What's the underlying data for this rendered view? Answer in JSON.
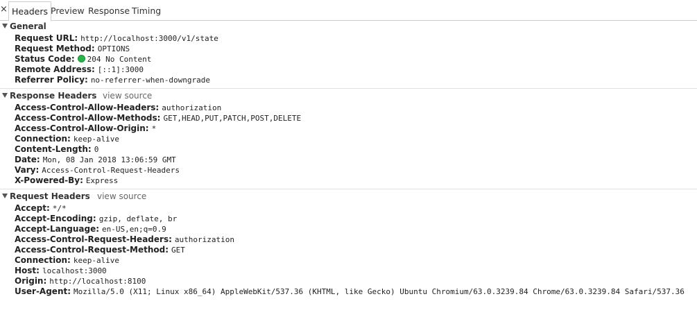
{
  "tabs": {
    "close_symbol": "×",
    "headers": "Headers",
    "preview": "Preview",
    "response": "Response",
    "timing": "Timing"
  },
  "general": {
    "title": "General",
    "request_url_key": "Request URL:",
    "request_url_val": "http://localhost:3000/v1/state",
    "request_method_key": "Request Method:",
    "request_method_val": "OPTIONS",
    "status_code_key": "Status Code:",
    "status_code_val": "204 No Content",
    "status_color": "#2bb44a",
    "remote_address_key": "Remote Address:",
    "remote_address_val": "[::1]:3000",
    "referrer_policy_key": "Referrer Policy:",
    "referrer_policy_val": "no-referrer-when-downgrade"
  },
  "response_headers": {
    "title": "Response Headers",
    "view_source": "view source",
    "items": [
      {
        "key": "Access-Control-Allow-Headers:",
        "value": "authorization"
      },
      {
        "key": "Access-Control-Allow-Methods:",
        "value": "GET,HEAD,PUT,PATCH,POST,DELETE"
      },
      {
        "key": "Access-Control-Allow-Origin:",
        "value": "*"
      },
      {
        "key": "Connection:",
        "value": "keep-alive"
      },
      {
        "key": "Content-Length:",
        "value": "0"
      },
      {
        "key": "Date:",
        "value": "Mon, 08 Jan 2018 13:06:59 GMT"
      },
      {
        "key": "Vary:",
        "value": "Access-Control-Request-Headers"
      },
      {
        "key": "X-Powered-By:",
        "value": "Express"
      }
    ]
  },
  "request_headers": {
    "title": "Request Headers",
    "view_source": "view source",
    "items": [
      {
        "key": "Accept:",
        "value": "*/*"
      },
      {
        "key": "Accept-Encoding:",
        "value": "gzip, deflate, br"
      },
      {
        "key": "Accept-Language:",
        "value": "en-US,en;q=0.9"
      },
      {
        "key": "Access-Control-Request-Headers:",
        "value": "authorization"
      },
      {
        "key": "Access-Control-Request-Method:",
        "value": "GET"
      },
      {
        "key": "Connection:",
        "value": "keep-alive"
      },
      {
        "key": "Host:",
        "value": "localhost:3000"
      },
      {
        "key": "Origin:",
        "value": "http://localhost:8100"
      },
      {
        "key": "User-Agent:",
        "value": "Mozilla/5.0 (X11; Linux x86_64) AppleWebKit/537.36 (KHTML, like Gecko) Ubuntu Chromium/63.0.3239.84 Chrome/63.0.3239.84 Safari/537.36"
      }
    ]
  }
}
